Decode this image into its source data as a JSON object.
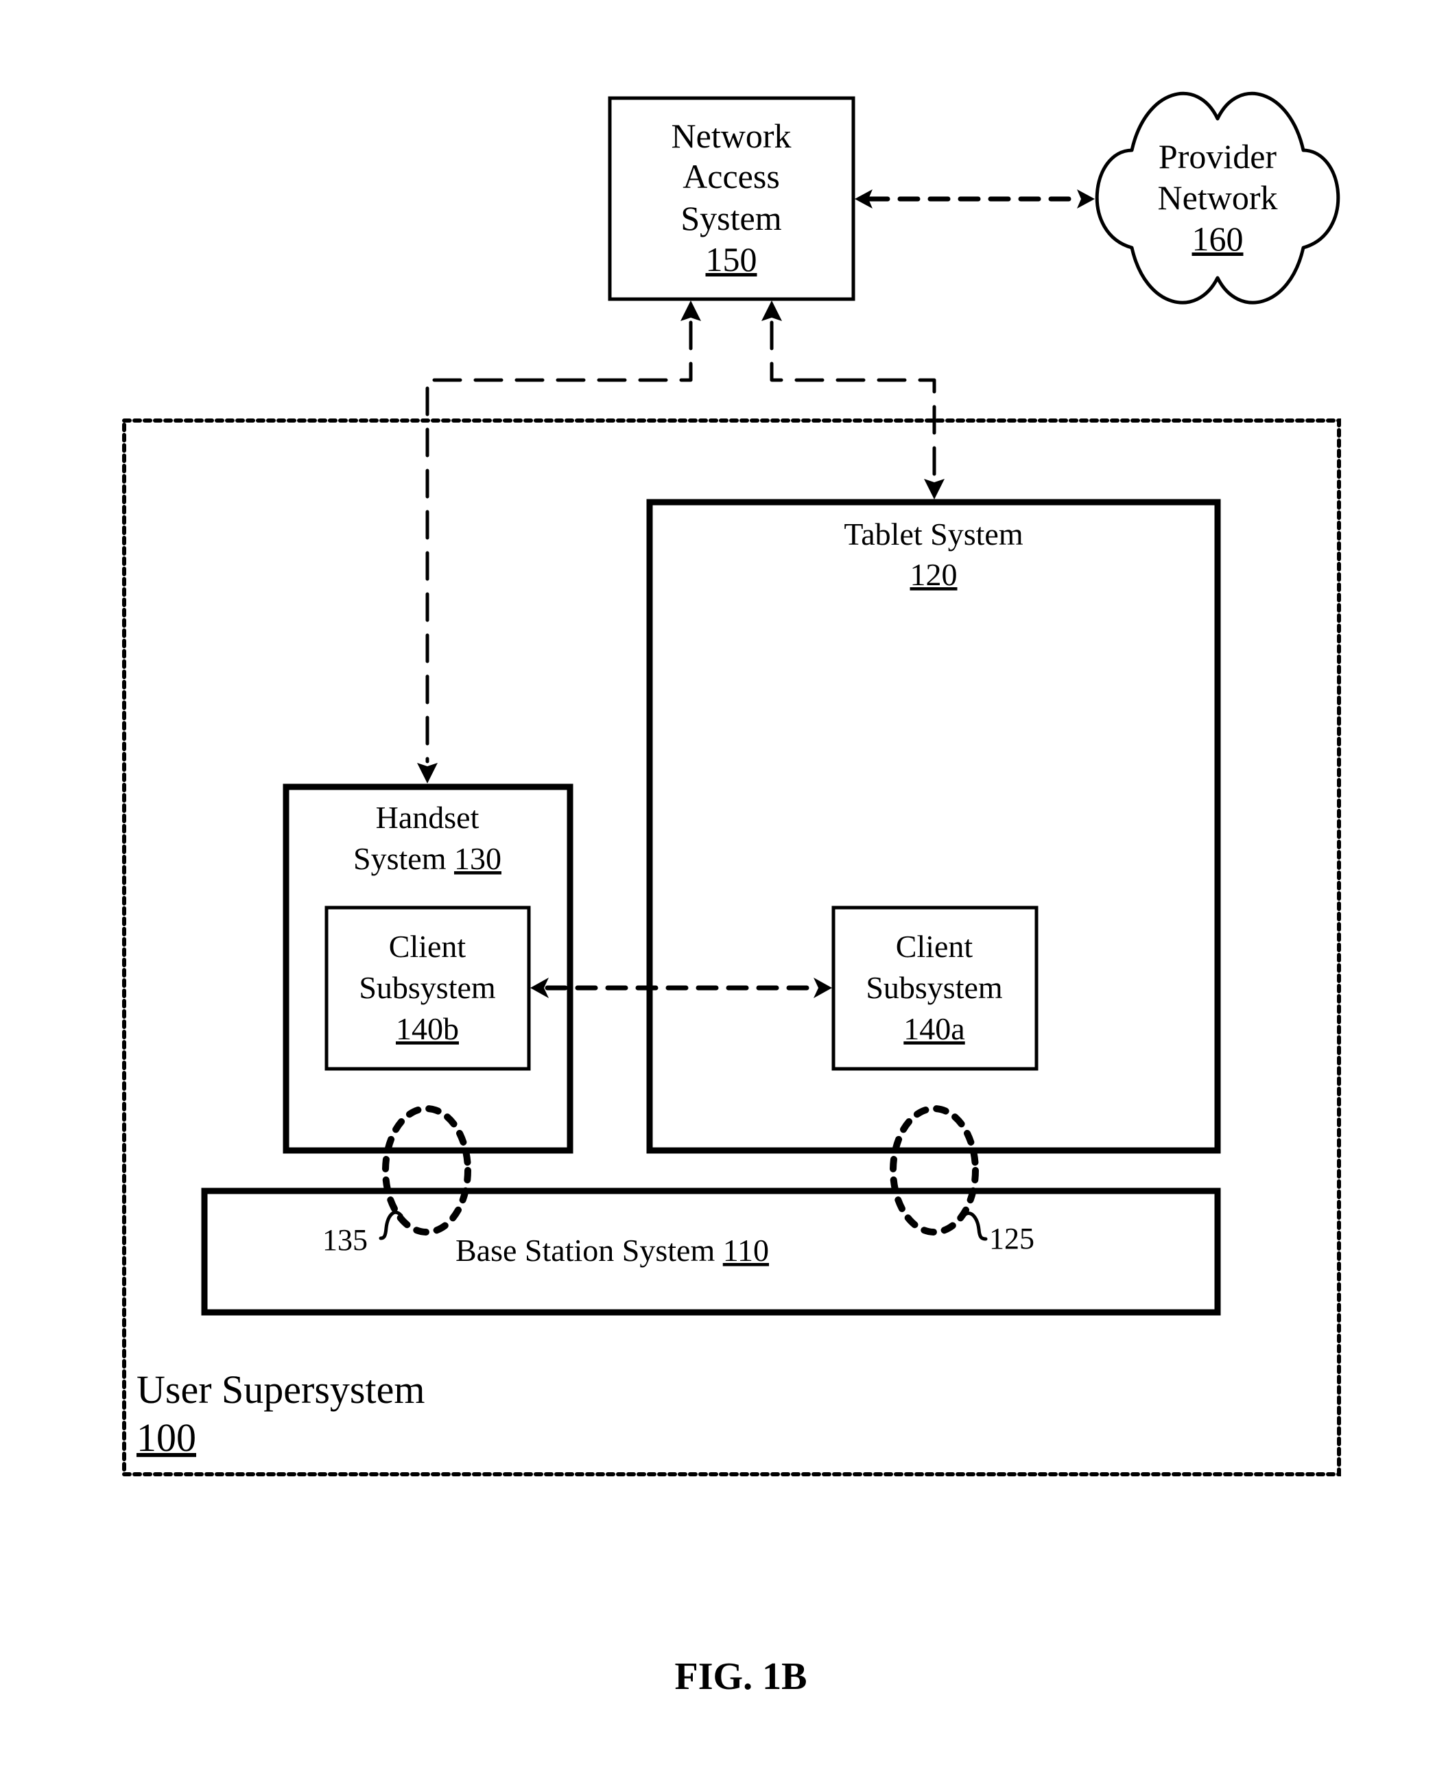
{
  "figure": {
    "caption": "FIG. 1B"
  },
  "nodes": {
    "network_access": {
      "lines": [
        "Network",
        "Access",
        "System"
      ],
      "ref": "150"
    },
    "provider_network": {
      "lines": [
        "Provider",
        "Network"
      ],
      "ref": "160"
    },
    "user_supersystem": {
      "lines": [
        "User Supersystem"
      ],
      "ref": "100"
    },
    "tablet": {
      "line": "Tablet System",
      "ref": "120"
    },
    "handset": {
      "line1": "Handset",
      "line2": "System ",
      "ref": "130"
    },
    "client_b": {
      "lines": [
        "Client",
        "Subsystem"
      ],
      "ref": "140b"
    },
    "client_a": {
      "lines": [
        "Client",
        "Subsystem"
      ],
      "ref": "140a"
    },
    "base_station": {
      "line": "Base Station System ",
      "ref": "110"
    }
  },
  "links": {
    "link_135": {
      "ref": "135"
    },
    "link_125": {
      "ref": "125"
    }
  },
  "edges": [
    {
      "from": "network_access",
      "to": "provider_network",
      "style": "dashed",
      "direction": "bidirectional"
    },
    {
      "from": "network_access",
      "to": "handset",
      "style": "dashed",
      "direction": "bidirectional"
    },
    {
      "from": "network_access",
      "to": "tablet",
      "style": "dashed",
      "direction": "bidirectional"
    },
    {
      "from": "client_b",
      "to": "client_a",
      "style": "dashed",
      "direction": "bidirectional"
    },
    {
      "from": "handset",
      "to": "base_station",
      "style": "dotted-ellipse",
      "label": "135"
    },
    {
      "from": "tablet",
      "to": "base_station",
      "style": "dotted-ellipse",
      "label": "125"
    }
  ]
}
